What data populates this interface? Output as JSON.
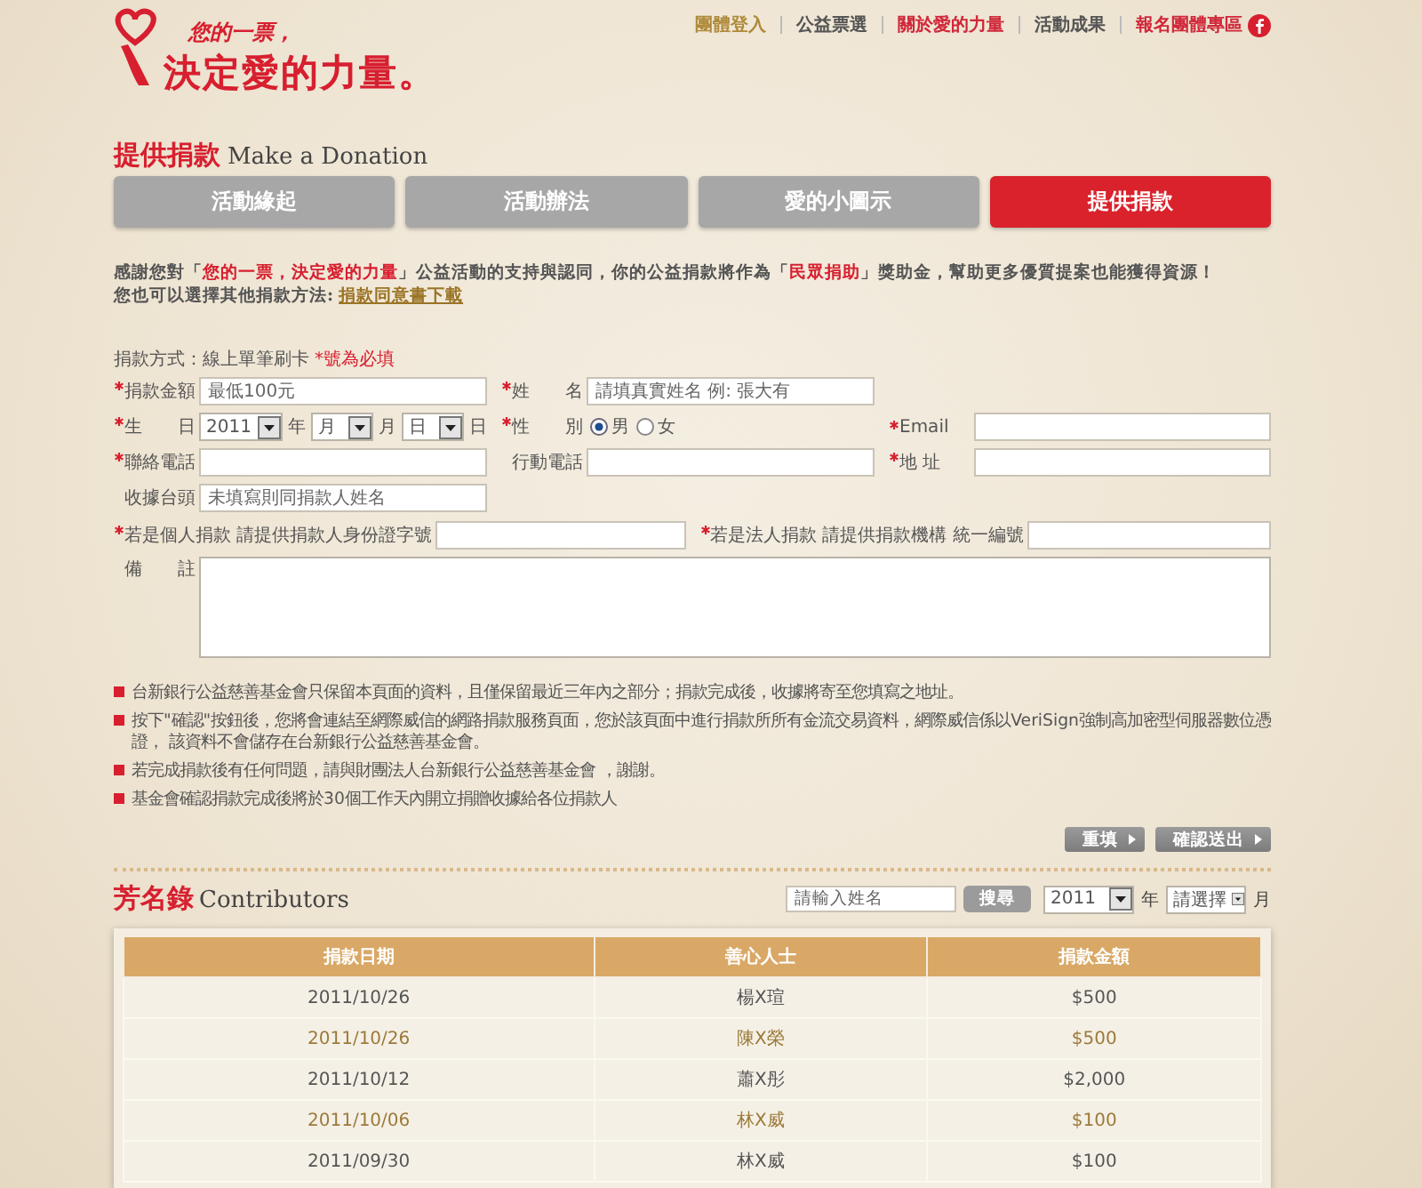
{
  "logo": {
    "line1": "您的一票，",
    "line2": "決定愛的力量。"
  },
  "top_nav": [
    {
      "label": "團體登入",
      "color": "#b08a3a"
    },
    {
      "label": "公益票選",
      "color": "#555555"
    },
    {
      "label": "關於愛的力量",
      "color": "#d0283a"
    },
    {
      "label": "活動成果",
      "color": "#555555"
    },
    {
      "label": "報名團體專區",
      "color": "#d0283a"
    }
  ],
  "page_title": {
    "zh": "提供捐款",
    "en": "Make a Donation"
  },
  "tabs": [
    {
      "label": "活動緣起",
      "selected": false
    },
    {
      "label": "活動辦法",
      "selected": false
    },
    {
      "label": "愛的小圖示",
      "selected": false
    },
    {
      "label": "提供捐款",
      "selected": true
    }
  ],
  "intro": {
    "text": "感謝您對「**您的一票，決定愛的力量**」公益活動的支持與認同，你的公益捐款將作為「**民眾捐助**」獎助金，幫助更多優質提案也能獲得資源！",
    "other": "您也可以選擇其他捐款方法:",
    "link": "捐款同意書下載"
  },
  "form": {
    "method": "捐款方式：線上單筆刷卡",
    "required_note": "*號為必填",
    "grid_rows": [
      [
        {
          "kind": "text",
          "label": "捐款金額",
          "required": true,
          "placeholder": "最低100元"
        },
        {
          "kind": "text",
          "label": "姓　　名",
          "required": true,
          "placeholder": "請填真實姓名 例: 張大有"
        }
      ],
      [
        {
          "kind": "date",
          "label": "生　　日",
          "required": true,
          "year": "2011",
          "year_unit": "年",
          "month": "月",
          "month_unit": "月",
          "day": "日",
          "day_unit": "日"
        },
        {
          "kind": "radio",
          "label": "性　　別",
          "required": true,
          "options": [
            {
              "label": "男",
              "selected": true
            },
            {
              "label": "女",
              "selected": false
            }
          ]
        },
        {
          "kind": "text",
          "label": "Email",
          "required": true
        }
      ],
      [
        {
          "kind": "text",
          "label": "聯絡電話",
          "required": true
        },
        {
          "kind": "text",
          "label": "行動電話",
          "required": false
        },
        {
          "kind": "text",
          "label": "地 址",
          "required": true
        }
      ],
      [
        {
          "kind": "text",
          "label": "收據台頭",
          "required": false,
          "placeholder": "未填寫則同捐款人姓名"
        }
      ]
    ],
    "id_fields": [
      {
        "kind": "text",
        "label": "若是個人捐款 請提供捐款人身份證字號",
        "required": true
      },
      {
        "kind": "text",
        "label": "若是法人捐款 請提供捐款機構 統一編號",
        "required": true
      }
    ],
    "remarks": {
      "label": "備　　註"
    }
  },
  "notes": [
    "台新銀行公益慈善基金會只保留本頁面的資料，且僅保留最近三年內之部分；捐款完成後，收據將寄至您填寫之地址。",
    "按下\"確認\"按鈕後，您將會連結至網際威信的網路捐款服務頁面，您於該頁面中進行捐款所所有金流交易資料，網際威信係以VeriSign強制高加密型伺服器數位憑證， 該資料不會儲存在台新銀行公益慈善基金會。",
    "若完成捐款後有任何問題，請與財團法人台新銀行公益慈善基金會 ，謝謝。",
    "基金會確認捐款完成後將於30個工作天內開立捐贈收據給各位捐款人"
  ],
  "actions": [
    "重填",
    "確認送出"
  ],
  "contributors": {
    "title_zh": "芳名錄",
    "title_en": "Contributors",
    "search_placeholder": "請輸入姓名",
    "search_button": "搜尋",
    "year": "2011",
    "year_unit": "年",
    "month": "請選擇",
    "month_unit": "月",
    "columns": [
      "捐款日期",
      "善心人士",
      "捐款金額"
    ],
    "rows": [
      [
        "2011/10/26",
        "楊X瑄",
        "$500"
      ],
      [
        "2011/10/26",
        "陳X榮",
        "$500"
      ],
      [
        "2011/10/12",
        "蕭X彤",
        "$2,000"
      ],
      [
        "2011/10/06",
        "林X威",
        "$100"
      ],
      [
        "2011/09/30",
        "林X威",
        "$100"
      ]
    ]
  }
}
